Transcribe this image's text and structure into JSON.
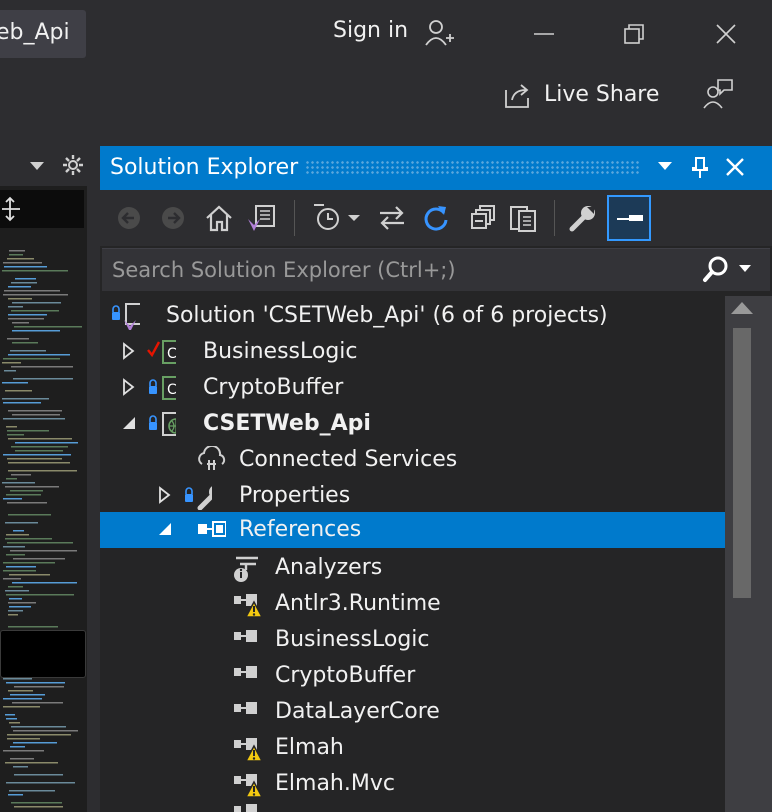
{
  "titlebar": {
    "project_tab": "eb_Api",
    "sign_in": "Sign in",
    "live_share": "Live Share"
  },
  "solution_explorer": {
    "title": "Solution Explorer",
    "search_placeholder": "Search Solution Explorer (Ctrl+;)",
    "toolbar": [
      "back-icon",
      "forward-icon",
      "home-icon",
      "switch-views-icon",
      "pending-changes-icon",
      "sync-icon",
      "refresh-icon",
      "collapse-all-icon",
      "show-all-files-icon",
      "properties-icon",
      "preview-icon"
    ],
    "tree": [
      {
        "label": "Solution 'CSETWeb_Api' (6 of 6 projects)",
        "icon": "solution-icon",
        "locked": true
      },
      {
        "label": "BusinessLogic",
        "icon": "csharp-project-icon",
        "expander": "collapsed",
        "status": "checked-in"
      },
      {
        "label": "CryptoBuffer",
        "icon": "csharp-project-icon",
        "expander": "collapsed",
        "locked": true
      },
      {
        "label": "CSETWeb_Api",
        "icon": "web-project-icon",
        "expander": "expanded",
        "locked": true,
        "bold": true
      },
      {
        "label": "Connected Services",
        "icon": "connected-services-icon"
      },
      {
        "label": "Properties",
        "icon": "wrench-icon",
        "expander": "collapsed",
        "locked": true
      },
      {
        "label": "References",
        "icon": "references-icon",
        "expander": "expanded",
        "selected": true
      },
      {
        "label": "Analyzers",
        "icon": "analyzers-icon"
      },
      {
        "label": "Antlr3.Runtime",
        "icon": "reference-warning-icon"
      },
      {
        "label": "BusinessLogic",
        "icon": "reference-icon"
      },
      {
        "label": "CryptoBuffer",
        "icon": "reference-icon"
      },
      {
        "label": "DataLayerCore",
        "icon": "reference-icon"
      },
      {
        "label": "Elmah",
        "icon": "reference-warning-icon"
      },
      {
        "label": "Elmah.Mvc",
        "icon": "reference-warning-icon"
      }
    ]
  },
  "colors": {
    "accent": "#007acc",
    "background": "#2d2d30",
    "panel": "#252526",
    "warning": "#f2c811",
    "csharp": "#68a063"
  }
}
